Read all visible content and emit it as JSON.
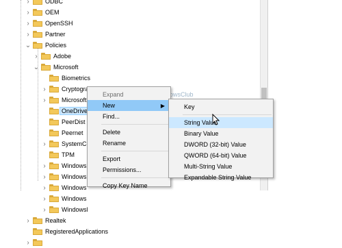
{
  "tree": {
    "items": [
      {
        "label": "ODBC",
        "level": 1,
        "expander": "›"
      },
      {
        "label": "OEM",
        "level": 1,
        "expander": "›"
      },
      {
        "label": "OpenSSH",
        "level": 1,
        "expander": "›"
      },
      {
        "label": "Partner",
        "level": 1,
        "expander": "›"
      },
      {
        "label": "Policies",
        "level": 1,
        "expander": "⌄"
      },
      {
        "label": "Adobe",
        "level": 2,
        "expander": "›"
      },
      {
        "label": "Microsoft",
        "level": 2,
        "expander": "⌄"
      },
      {
        "label": "Biometrics",
        "level": 3,
        "expander": ""
      },
      {
        "label": "Cryptography",
        "level": 3,
        "expander": "›"
      },
      {
        "label": "MicrosoftEdge",
        "level": 3,
        "expander": "›"
      },
      {
        "label": "OneDrive",
        "level": 3,
        "expander": "",
        "selected": true
      },
      {
        "label": "PeerDist",
        "level": 3,
        "expander": ""
      },
      {
        "label": "Peernet",
        "level": 3,
        "expander": ""
      },
      {
        "label": "SystemCe",
        "level": 3,
        "expander": "›"
      },
      {
        "label": "TPM",
        "level": 3,
        "expander": ""
      },
      {
        "label": "Windows",
        "level": 3,
        "expander": "›"
      },
      {
        "label": "Windows",
        "level": 3,
        "expander": "›"
      },
      {
        "label": "Windows",
        "level": 3,
        "expander": "›"
      },
      {
        "label": "Windows",
        "level": 3,
        "expander": "›"
      },
      {
        "label": "Windowsl",
        "level": 3,
        "expander": "›"
      },
      {
        "label": "Realtek",
        "level": 1,
        "expander": "›"
      },
      {
        "label": "RegisteredApplications",
        "level": 1,
        "expander": ""
      },
      {
        "label": "",
        "level": 1,
        "expander": "›"
      }
    ]
  },
  "watermark": "TheWindowsClub",
  "context_menu": {
    "items": [
      {
        "label": "Expand",
        "disabled": true
      },
      {
        "label": "New",
        "submenu": true,
        "hover": true
      },
      {
        "label": "Find...",
        "sep_after": true
      },
      {
        "label": "Delete"
      },
      {
        "label": "Rename",
        "sep_after": true
      },
      {
        "label": "Export"
      },
      {
        "label": "Permissions...",
        "sep_after": true
      },
      {
        "label": "Copy Key Name"
      }
    ]
  },
  "new_submenu": {
    "items": [
      {
        "label": "Key",
        "sep_after": true
      },
      {
        "label": "String Value",
        "highlighted": true
      },
      {
        "label": "Binary Value"
      },
      {
        "label": "DWORD (32-bit) Value"
      },
      {
        "label": "QWORD (64-bit) Value"
      },
      {
        "label": "Multi-String Value"
      },
      {
        "label": "Expandable String Value"
      }
    ]
  },
  "colors": {
    "folder": "#f3c85a",
    "highlight": "#91c9f7",
    "selected": "#cce8ff"
  }
}
